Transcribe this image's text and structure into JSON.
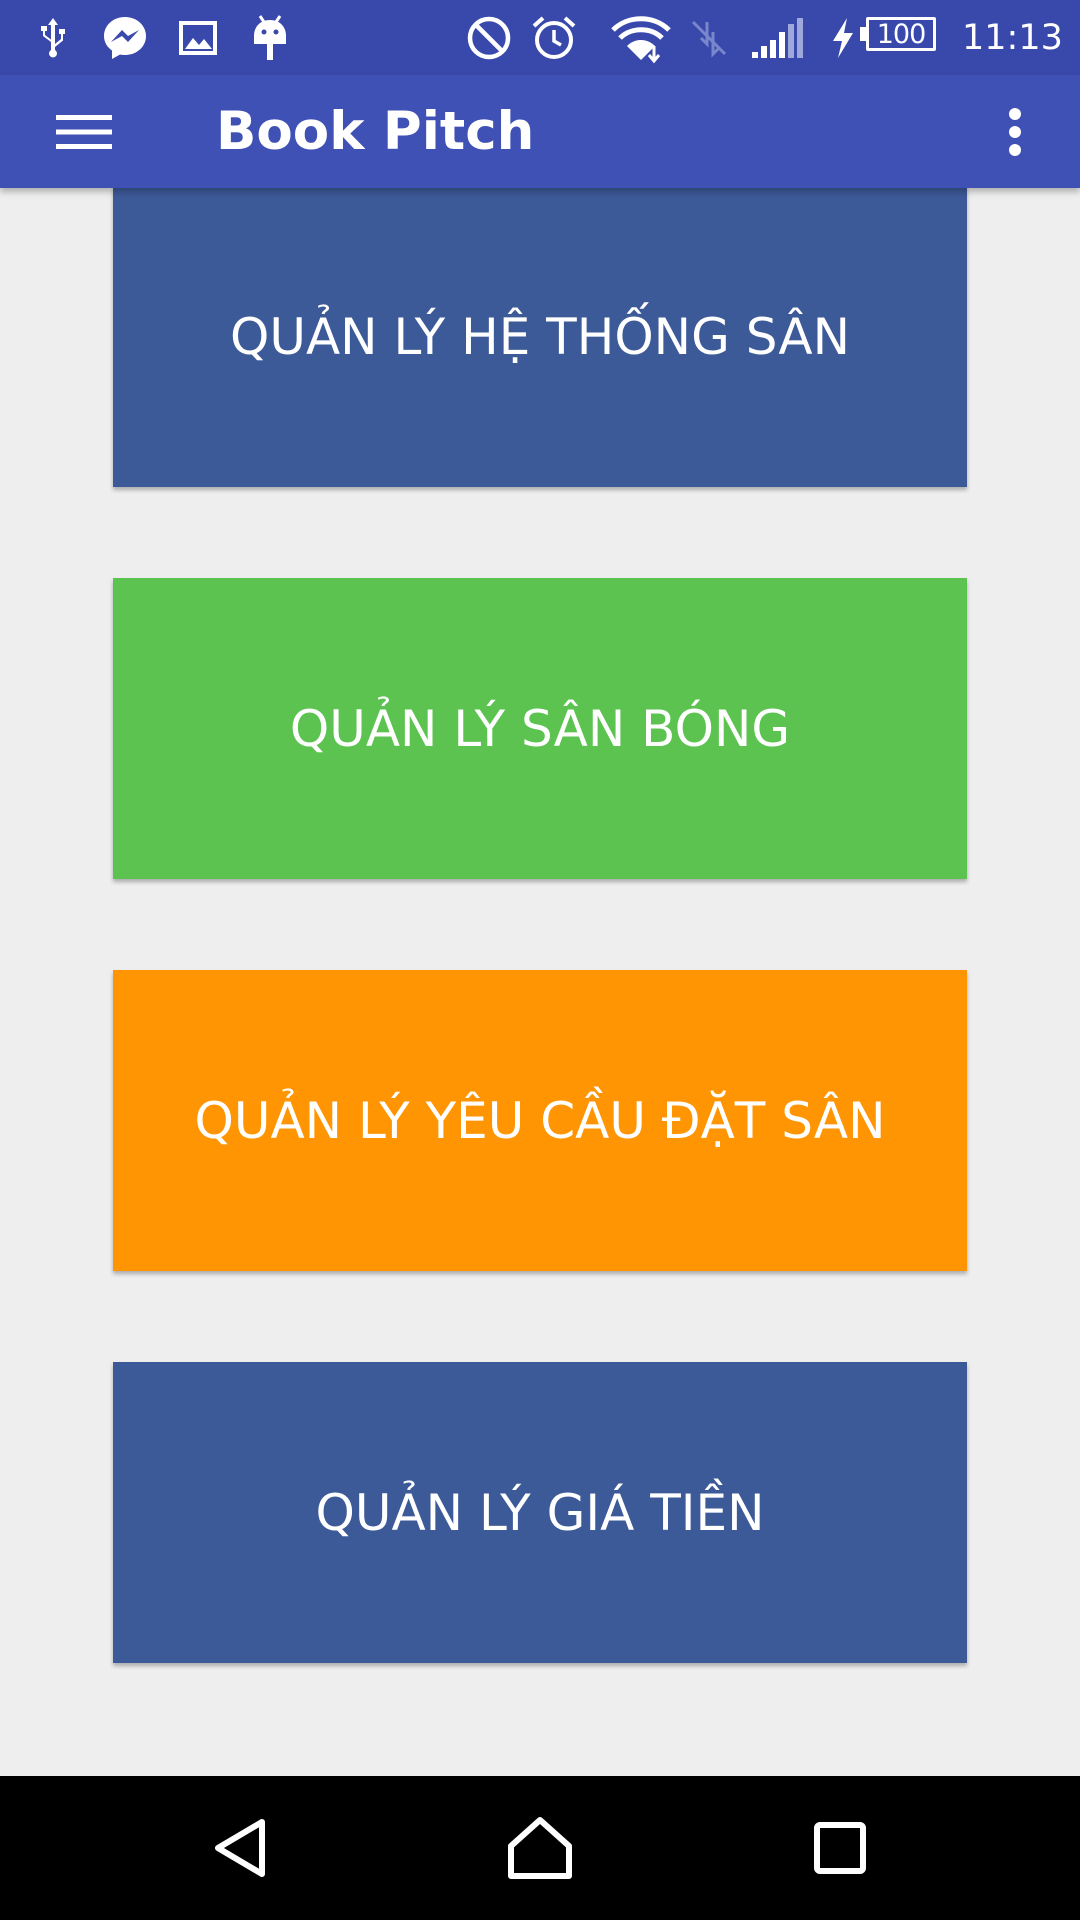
{
  "status_bar": {
    "icons": [
      "usb-icon",
      "messenger-icon",
      "gallery-icon",
      "android-icon",
      "do-not-disturb-icon",
      "alarm-icon",
      "wifi-icon",
      "no-sim-icon",
      "cell-signal-icon",
      "charging-icon"
    ],
    "battery_level": "100",
    "time": "11:13"
  },
  "app_bar": {
    "title": "Book Pitch",
    "menu_icon": "hamburger-menu-icon",
    "overflow_icon": "more-vert-icon"
  },
  "tiles": [
    {
      "label": "QUẢN LÝ HỆ THỐNG SÂN",
      "color": "#3d5a98"
    },
    {
      "label": "QUẢN LÝ SÂN BÓNG",
      "color": "#5cc350"
    },
    {
      "label": "QUẢN LÝ YÊU CẦU ĐẶT SÂN",
      "color": "#ff9502"
    },
    {
      "label": "QUẢN LÝ GIÁ TIỀN",
      "color": "#3d5a98"
    }
  ],
  "nav_bar": {
    "buttons": [
      "back-icon",
      "home-icon",
      "recents-icon"
    ]
  },
  "colors": {
    "status_bar": "#3949ab",
    "app_bar": "#3f51b5",
    "background": "#eeeeee"
  }
}
